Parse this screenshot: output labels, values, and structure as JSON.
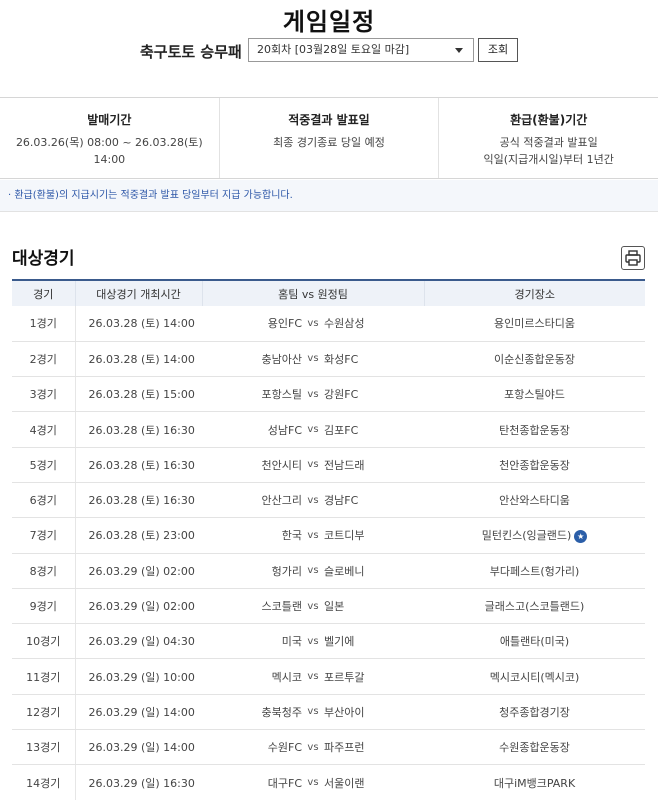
{
  "page": {
    "title": "게임일정"
  },
  "selector": {
    "game_name": "축구토토 승무패",
    "round_value": "20회차 [03월28일 토요일 마감]",
    "search_label": "조회"
  },
  "info": [
    {
      "label": "발매기간",
      "lines": [
        "26.03.26(목) 08:00 ~ 26.03.28(토) 14:00"
      ]
    },
    {
      "label": "적중결과 발표일",
      "lines": [
        "최종 경기종료 당일 예정"
      ]
    },
    {
      "label": "환급(환불)기간",
      "lines": [
        "공식 적중결과 발표일",
        "익일(지급개시일)부터 1년간"
      ]
    }
  ],
  "notice": "· 환급(환불)의 지급시기는 적중결과 발표 당일부터 지급 가능합니다.",
  "section": {
    "title": "대상경기",
    "print_icon": "printer-icon"
  },
  "table": {
    "headers": [
      "경기",
      "대상경기 개최시간",
      "홈팀 vs 원정팀",
      "경기장소"
    ],
    "vs": "vs",
    "rows": [
      {
        "no": "1경기",
        "time": "26.03.28 (토) 14:00",
        "home": "용인FC",
        "away": "수원삼성",
        "venue": "용인미르스타디움"
      },
      {
        "no": "2경기",
        "time": "26.03.28 (토) 14:00",
        "home": "충남아산",
        "away": "화성FC",
        "venue": "이순신종합운동장"
      },
      {
        "no": "3경기",
        "time": "26.03.28 (토) 15:00",
        "home": "포항스틸",
        "away": "강원FC",
        "venue": "포항스틸야드"
      },
      {
        "no": "4경기",
        "time": "26.03.28 (토) 16:30",
        "home": "성남FC",
        "away": "김포FC",
        "venue": "탄천종합운동장"
      },
      {
        "no": "5경기",
        "time": "26.03.28 (토) 16:30",
        "home": "천안시티",
        "away": "전남드래",
        "venue": "천안종합운동장"
      },
      {
        "no": "6경기",
        "time": "26.03.28 (토) 16:30",
        "home": "안산그리",
        "away": "경남FC",
        "venue": "안산와스타디움"
      },
      {
        "no": "7경기",
        "time": "26.03.28 (토) 23:00",
        "home": "한국",
        "away": "코트디부",
        "venue": "밀턴킨스(잉글랜드)",
        "badge": "★"
      },
      {
        "no": "8경기",
        "time": "26.03.29 (일) 02:00",
        "home": "헝가리",
        "away": "슬로베니",
        "venue": "부다페스트(헝가리)"
      },
      {
        "no": "9경기",
        "time": "26.03.29 (일) 02:00",
        "home": "스코틀랜",
        "away": "일본",
        "venue": "글래스고(스코틀랜드)"
      },
      {
        "no": "10경기",
        "time": "26.03.29 (일) 04:30",
        "home": "미국",
        "away": "벨기에",
        "venue": "애틀랜타(미국)"
      },
      {
        "no": "11경기",
        "time": "26.03.29 (일) 10:00",
        "home": "멕시코",
        "away": "포르투갈",
        "venue": "멕시코시티(멕시코)"
      },
      {
        "no": "12경기",
        "time": "26.03.29 (일) 14:00",
        "home": "충북청주",
        "away": "부산아이",
        "venue": "청주종합경기장"
      },
      {
        "no": "13경기",
        "time": "26.03.29 (일) 14:00",
        "home": "수원FC",
        "away": "파주프런",
        "venue": "수원종합운동장"
      },
      {
        "no": "14경기",
        "time": "26.03.29 (일) 16:30",
        "home": "대구FC",
        "away": "서울이랜",
        "venue": "대구iM뱅크PARK"
      }
    ]
  },
  "colors": {
    "accent": "#3a5a8c",
    "header_bg": "#eef2f8",
    "notice_text": "#2d57a8"
  }
}
